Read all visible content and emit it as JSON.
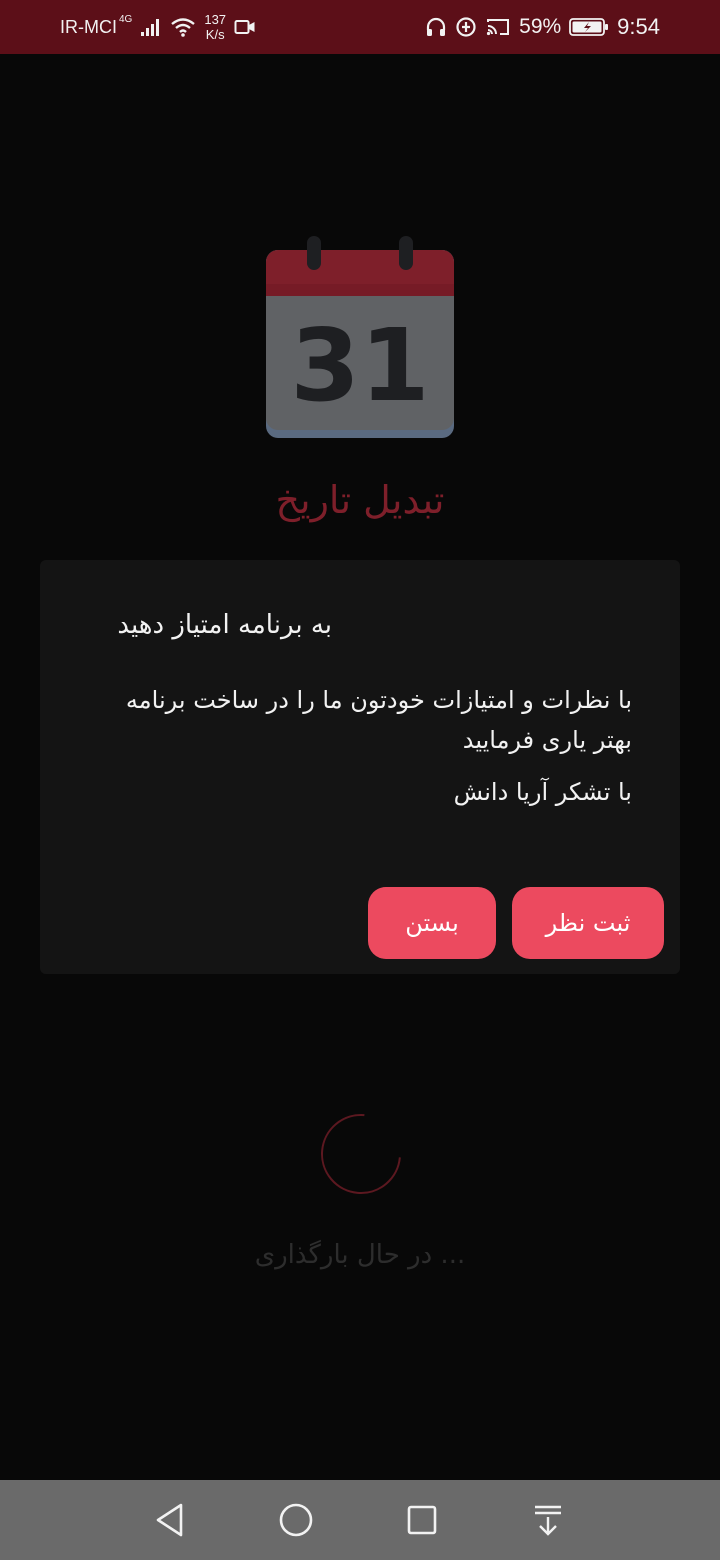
{
  "status_bar": {
    "carrier": "IR-MCI",
    "network_type": "4G",
    "speed_value": "137",
    "speed_unit": "K/s",
    "battery_percent": "59%",
    "time": "9:54",
    "icons": [
      "signal-icon",
      "wifi-icon",
      "video-camera-icon",
      "headphones-icon",
      "data-saver-icon",
      "cast-icon",
      "battery-icon"
    ]
  },
  "splash": {
    "calendar_day": "31",
    "app_title": "تبدیل تاریخ",
    "loading_text": "... در حال بارگذاری"
  },
  "dialog": {
    "title": "به برنامه امتیاز دهید",
    "message": "با نظرات و امتیازات خودتون ما را در ساخت برنامه بهتر یاری فرمایید",
    "thanks": "با تشکر آریا دانش",
    "submit_label": "ثبت نظر",
    "close_label": "بستن"
  },
  "colors": {
    "status_bar_bg": "#5c0f18",
    "accent_button": "#ec4a5f",
    "dialog_bg": "#141414",
    "app_title": "#7e1f2a",
    "nav_bar_bg": "#6a6a6a"
  },
  "nav_bar": {
    "icons": [
      "back-icon",
      "home-icon",
      "recent-apps-icon",
      "notification-pull-icon"
    ]
  }
}
